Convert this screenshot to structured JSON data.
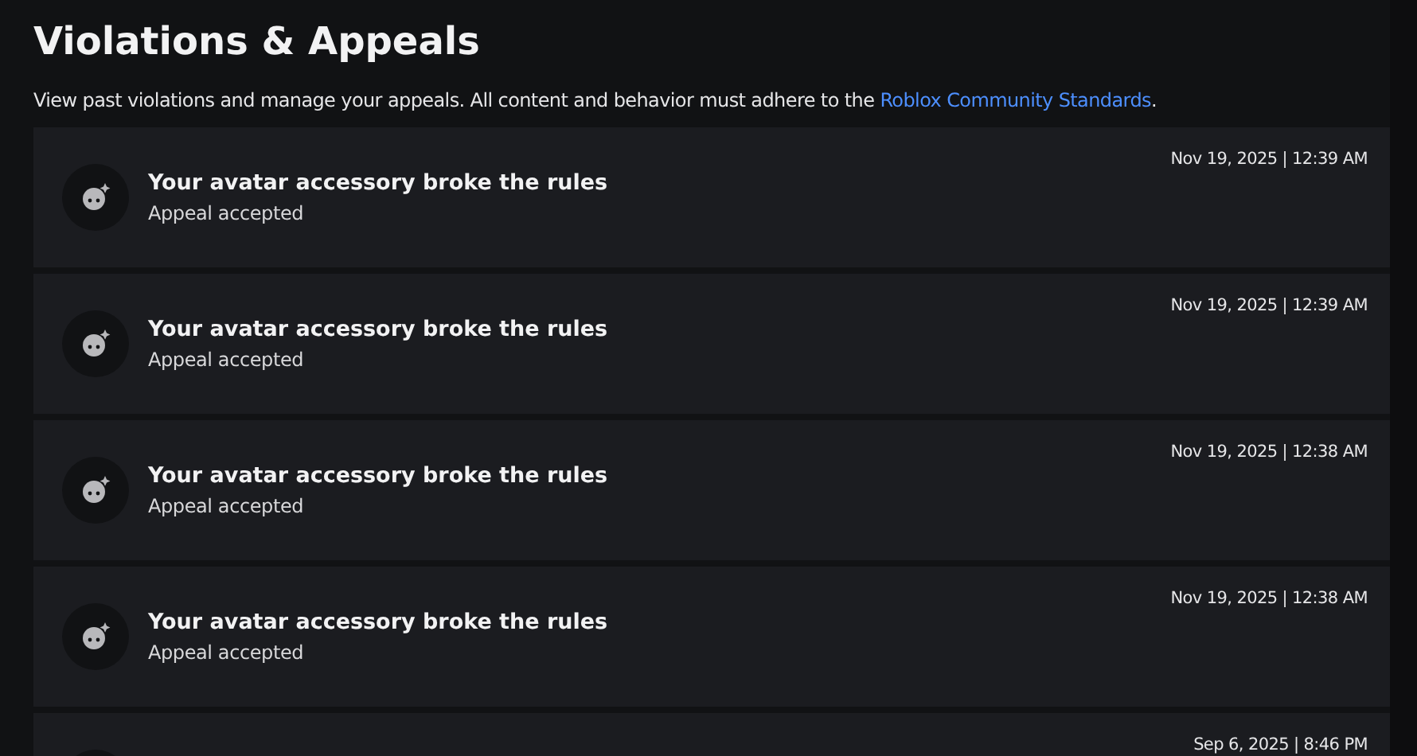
{
  "page": {
    "title": "Violations & Appeals",
    "description": "View past violations and manage your appeals. All content and behavior must adhere to the ",
    "link": "Roblox Community Standards",
    "description_end": "."
  },
  "violations": [
    {
      "title": "Your avatar accessory broke the rules",
      "status": "Appeal accepted",
      "timestamp": "Nov 19, 2025 | 12:39 AM"
    },
    {
      "title": "Your avatar accessory broke the rules",
      "status": "Appeal accepted",
      "timestamp": "Nov 19, 2025 | 12:39 AM"
    },
    {
      "title": "Your avatar accessory broke the rules",
      "status": "Appeal accepted",
      "timestamp": "Nov 19, 2025 | 12:38 AM"
    },
    {
      "title": "Your avatar accessory broke the rules",
      "status": "Appeal accepted",
      "timestamp": "Nov 19, 2025 | 12:38 AM"
    },
    {
      "timestamp": "Sep 6, 2025 | 8:46 PM"
    }
  ]
}
